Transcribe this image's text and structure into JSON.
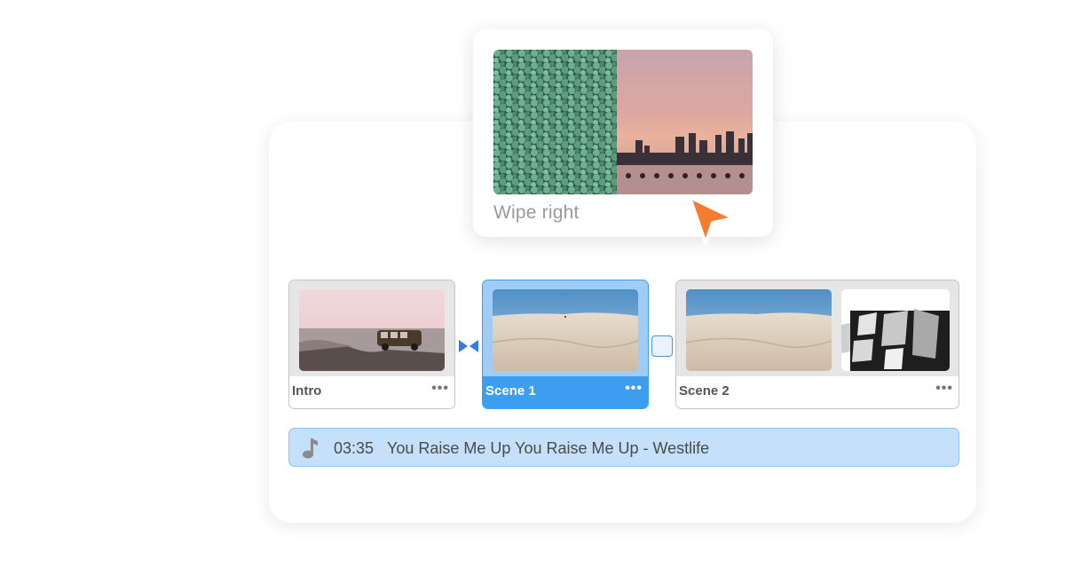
{
  "transition_popup": {
    "label": "Wipe right",
    "preview_left": "green-foliage",
    "preview_right": "city-skyline-sunset"
  },
  "timeline": {
    "clips": [
      {
        "name": "Intro",
        "thumbnail": "van-on-beach",
        "selected": false
      },
      {
        "name": "Scene 1",
        "thumbnail": "sand-dunes",
        "selected": true
      },
      {
        "name": "Scene 2",
        "thumbnail": "sand-dunes-with-transition",
        "selected": false
      }
    ],
    "more_icon": "•••"
  },
  "audio": {
    "icon": "music-note-icon",
    "duration": "03:35",
    "title": "You Raise Me Up You Raise Me Up - Westlife"
  },
  "colors": {
    "selected_clip": "#3d9ef0",
    "audio_track": "#c5e0fb",
    "cursor": "#f47b30"
  }
}
